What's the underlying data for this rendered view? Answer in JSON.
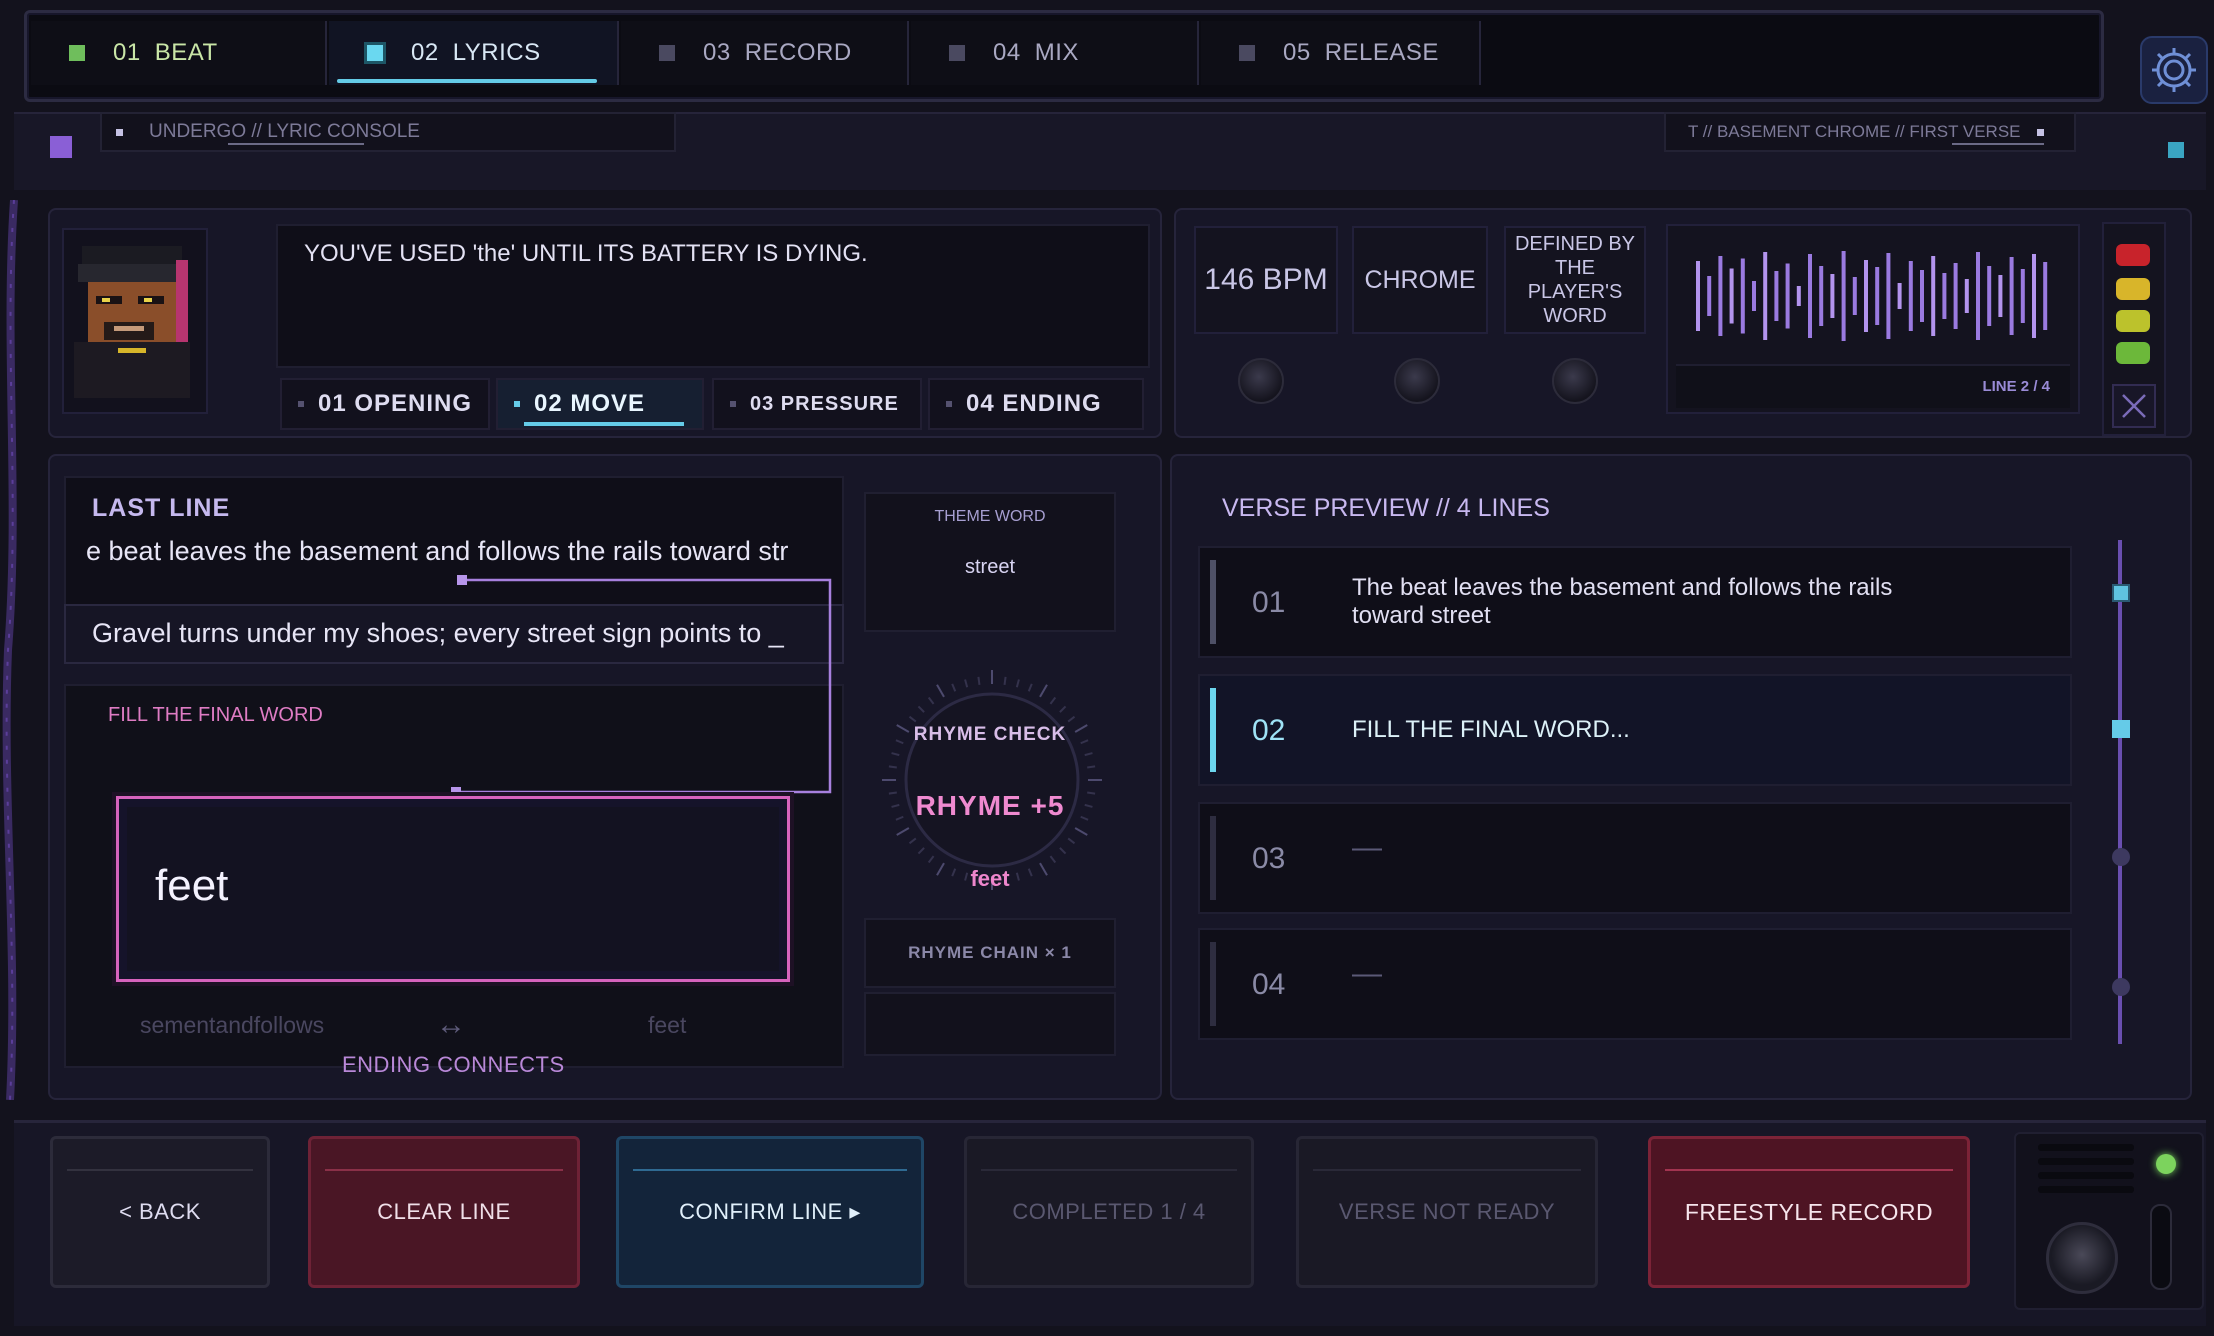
{
  "tabs": [
    {
      "num": "01",
      "label": "BEAT"
    },
    {
      "num": "02",
      "label": "LYRICS"
    },
    {
      "num": "03",
      "label": "RECORD"
    },
    {
      "num": "04",
      "label": "MIX"
    },
    {
      "num": "05",
      "label": "RELEASE"
    }
  ],
  "active_tab": "02 LYRICS",
  "subheader": {
    "left": "UNDERGO // LYRIC CONSOLE",
    "right": "T // BASEMENT CHROME  //  FIRST VERSE"
  },
  "message": "YOU'VE USED 'the' UNTIL ITS BATTERY IS DYING.",
  "stages": [
    {
      "label": "01 OPENING"
    },
    {
      "label": "02 MOVE"
    },
    {
      "label": "03 PRESSURE"
    },
    {
      "label": "04 ENDING"
    }
  ],
  "active_stage": "02 MOVE",
  "info_cards": {
    "bpm": "146 BPM",
    "style": "CHROME",
    "defined": "DEFINED BY THE PLAYER'S WORD"
  },
  "waveform": {
    "line_label": "LINE 2 / 4"
  },
  "last_line": {
    "title": "LAST LINE",
    "text": "e beat leaves the basement and follows the rails toward str"
  },
  "current_line": {
    "text": "Gravel turns under my shoes; every street sign points to _"
  },
  "fill": {
    "title": "FILL THE FINAL WORD",
    "answer": "feet"
  },
  "ending": {
    "left_word": "sementandfollows",
    "arrow": "↔",
    "right_word": "feet",
    "caption": "ENDING CONNECTS"
  },
  "theme": {
    "label": "THEME WORD",
    "word": "street"
  },
  "rhyme": {
    "check": "RHYME CHECK",
    "score": "RHYME  +5",
    "word": "feet",
    "chain": "RHYME CHAIN  × 1"
  },
  "verse": {
    "title": "VERSE PREVIEW // 4 LINES",
    "rows": [
      {
        "num": "01",
        "text": "The beat leaves the basement and follows the rails toward street"
      },
      {
        "num": "02",
        "text": "FILL THE FINAL WORD..."
      },
      {
        "num": "03",
        "text": "—"
      },
      {
        "num": "04",
        "text": "—"
      }
    ]
  },
  "buttons": {
    "back": "<  BACK",
    "clear": "CLEAR LINE",
    "confirm": "CONFIRM LINE  ▸",
    "completed": "COMPLETED 1 / 4",
    "not_ready": "VERSE NOT READY",
    "freestyle": "FREESTYLE RECORD"
  },
  "colors": {
    "accent_cyan": "#65cbe8",
    "accent_pink": "#d763bd",
    "accent_purple": "#8f6bd8",
    "light_red": "#c8232b",
    "light_yellow": "#d8b52a",
    "light_yellow2": "#bcc22c",
    "light_green": "#6cb83a"
  }
}
